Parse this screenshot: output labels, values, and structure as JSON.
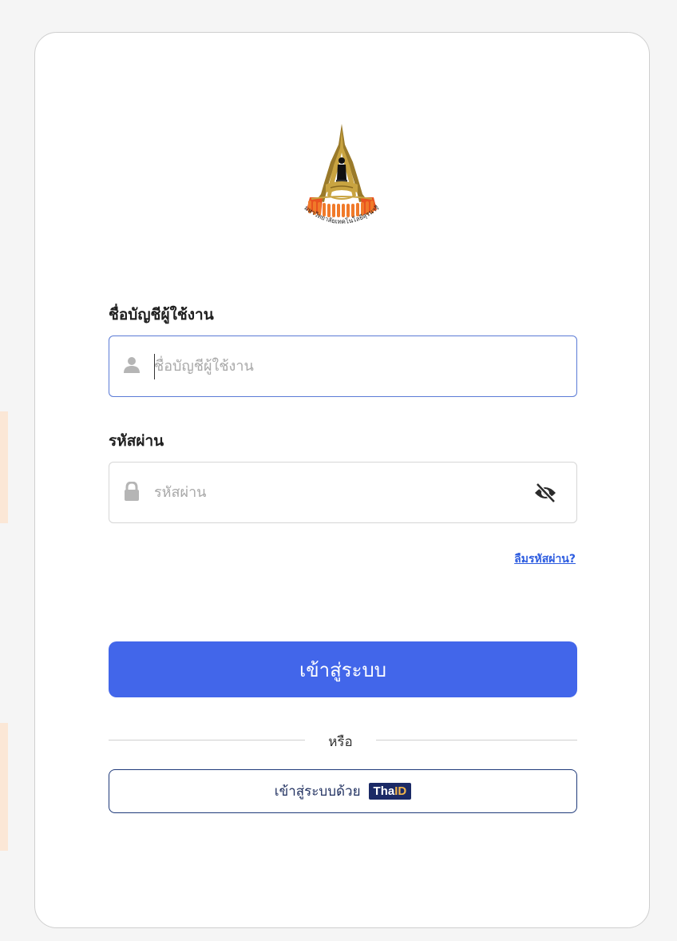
{
  "logo": {
    "icon": "suranaree-university-emblem-icon",
    "text": "มหาวิทยาลัยเทคโนโลยีสุรนารี"
  },
  "form": {
    "username": {
      "label": "ชื่อบัญชีผู้ใช้งาน",
      "placeholder": "ชื่อบัญชีผู้ใช้งาน",
      "value": "",
      "icon": "user-icon"
    },
    "password": {
      "label": "รหัสผ่าน",
      "placeholder": "รหัสผ่าน",
      "value": "",
      "icon": "lock-icon",
      "toggle_icon": "eye-slash-icon"
    },
    "forgot_password": "ลืมรหัสผ่าน?",
    "login_button": "เข้าสู่ระบบ",
    "divider_text": "หรือ",
    "thaid_button": {
      "label": "เข้าสู่ระบบด้วย",
      "badge_prefix": "Tha",
      "badge_suffix": "ID"
    }
  },
  "colors": {
    "primary": "#4266ea",
    "link": "#2e5de0",
    "thaid_navy": "#1b2a66",
    "thaid_gold": "#f2b54b",
    "focus_border": "#5b7bd6"
  }
}
